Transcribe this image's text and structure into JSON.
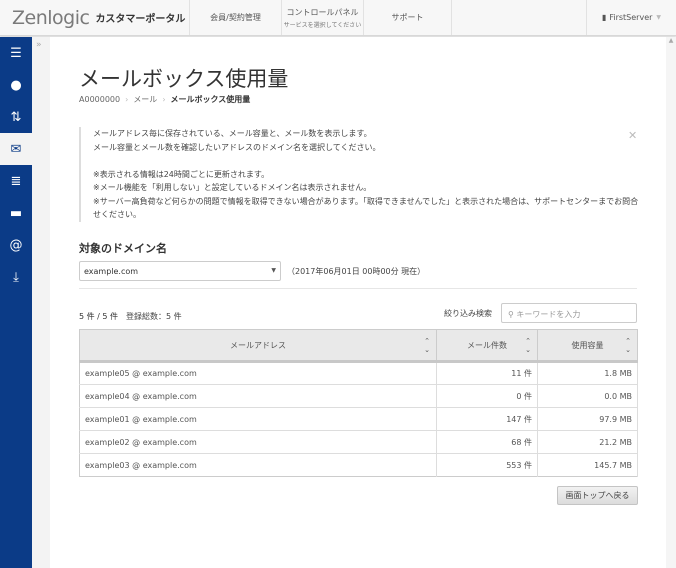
{
  "header": {
    "logo": "Zenlogic",
    "portal": "カスタマーポータル",
    "nav": [
      {
        "label": "会員/契約管理"
      },
      {
        "label": "コントロールパネル",
        "sub": "サービスを選択してください"
      },
      {
        "label": "サポート"
      }
    ],
    "user": "FirstServer"
  },
  "sidebar": {
    "items": [
      {
        "icon": "server-icon"
      },
      {
        "icon": "globe-icon"
      },
      {
        "icon": "transfer-icon"
      },
      {
        "icon": "mail-icon",
        "active": true
      },
      {
        "icon": "database-icon"
      },
      {
        "icon": "folder-icon"
      },
      {
        "icon": "at-icon"
      },
      {
        "icon": "download-icon"
      }
    ]
  },
  "page": {
    "title": "メールボックス使用量",
    "breadcrumb": [
      "A0000000",
      "メール",
      "メールボックス使用量"
    ]
  },
  "notice": {
    "lines": [
      "メールアドレス毎に保存されている、メール容量と、メール数を表示します。",
      "メール容量とメール数を確認したいアドレスのドメイン名を選択してください。",
      "※表示される情報は24時間ごとに更新されます。",
      "※メール機能を「利用しない」と設定しているドメイン名は表示されません。",
      "※サーバー高負荷など何らかの問題で情報を取得できない場合があります。「取得できませんでした」と表示された場合は、サポートセンターまでお問合せください。"
    ]
  },
  "domain": {
    "heading": "対象のドメイン名",
    "selected": "example.com",
    "as_of": "（2017年06月01日 00時00分 現在）"
  },
  "list": {
    "count": "5 件 / 5 件",
    "total": "登録総数：5 件",
    "filter_label": "絞り込み検索",
    "search_placeholder": "キーワードを入力",
    "columns": [
      "メールアドレス",
      "メール件数",
      "使用容量"
    ],
    "rows": [
      [
        "example05 @ example.com",
        "11 件",
        "1.8 MB"
      ],
      [
        "example04 @ example.com",
        "0 件",
        "0.0 MB"
      ],
      [
        "example01 @ example.com",
        "147 件",
        "97.9 MB"
      ],
      [
        "example02 @ example.com",
        "68 件",
        "21.2 MB"
      ],
      [
        "example03 @ example.com",
        "553 件",
        "145.7 MB"
      ]
    ]
  },
  "back_button": "画面トップへ戻る"
}
